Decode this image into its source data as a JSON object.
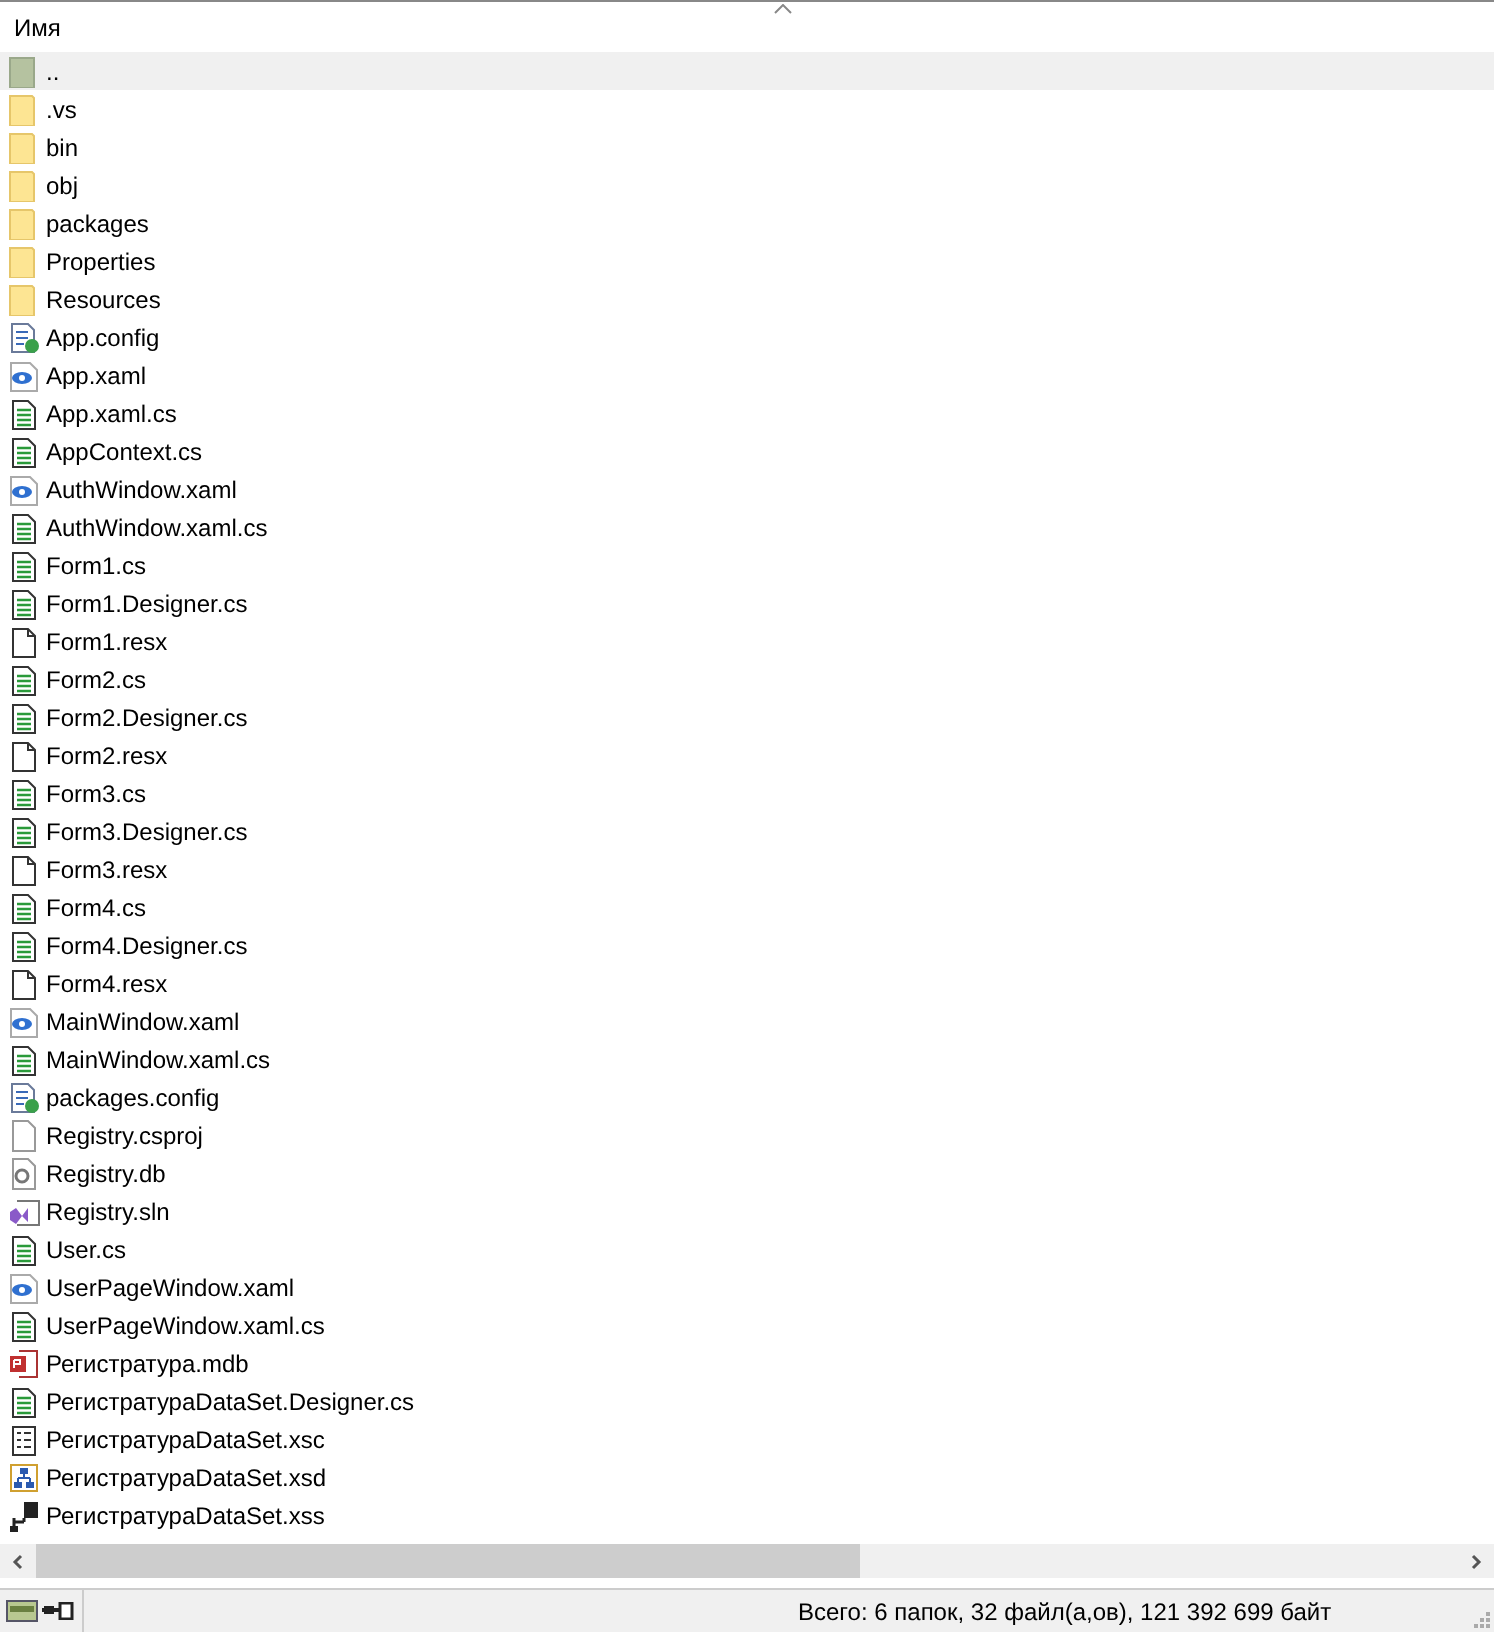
{
  "column": {
    "label": "Имя",
    "sort_ascending": true
  },
  "files": [
    {
      "name": "..",
      "kind": "up",
      "selected": true
    },
    {
      "name": ".vs",
      "kind": "folder",
      "selected": false
    },
    {
      "name": "bin",
      "kind": "folder",
      "selected": false
    },
    {
      "name": "obj",
      "kind": "folder",
      "selected": false
    },
    {
      "name": "packages",
      "kind": "folder",
      "selected": false
    },
    {
      "name": "Properties",
      "kind": "folder",
      "selected": false
    },
    {
      "name": "Resources",
      "kind": "folder",
      "selected": false
    },
    {
      "name": "App.config",
      "kind": "config",
      "selected": false
    },
    {
      "name": "App.xaml",
      "kind": "xaml",
      "selected": false
    },
    {
      "name": "App.xaml.cs",
      "kind": "cs",
      "selected": false
    },
    {
      "name": "AppContext.cs",
      "kind": "cs",
      "selected": false
    },
    {
      "name": "AuthWindow.xaml",
      "kind": "xaml",
      "selected": false
    },
    {
      "name": "AuthWindow.xaml.cs",
      "kind": "cs",
      "selected": false
    },
    {
      "name": "Form1.cs",
      "kind": "cs",
      "selected": false
    },
    {
      "name": "Form1.Designer.cs",
      "kind": "cs",
      "selected": false
    },
    {
      "name": "Form1.resx",
      "kind": "resx",
      "selected": false
    },
    {
      "name": "Form2.cs",
      "kind": "cs",
      "selected": false
    },
    {
      "name": "Form2.Designer.cs",
      "kind": "cs",
      "selected": false
    },
    {
      "name": "Form2.resx",
      "kind": "resx",
      "selected": false
    },
    {
      "name": "Form3.cs",
      "kind": "cs",
      "selected": false
    },
    {
      "name": "Form3.Designer.cs",
      "kind": "cs",
      "selected": false
    },
    {
      "name": "Form3.resx",
      "kind": "resx",
      "selected": false
    },
    {
      "name": "Form4.cs",
      "kind": "cs",
      "selected": false
    },
    {
      "name": "Form4.Designer.cs",
      "kind": "cs",
      "selected": false
    },
    {
      "name": "Form4.resx",
      "kind": "resx",
      "selected": false
    },
    {
      "name": "MainWindow.xaml",
      "kind": "xaml",
      "selected": false
    },
    {
      "name": "MainWindow.xaml.cs",
      "kind": "cs",
      "selected": false
    },
    {
      "name": "packages.config",
      "kind": "config",
      "selected": false
    },
    {
      "name": "Registry.csproj",
      "kind": "blank",
      "selected": false
    },
    {
      "name": "Registry.db",
      "kind": "db",
      "selected": false
    },
    {
      "name": "Registry.sln",
      "kind": "sln",
      "selected": false
    },
    {
      "name": "User.cs",
      "kind": "cs",
      "selected": false
    },
    {
      "name": "UserPageWindow.xaml",
      "kind": "xaml",
      "selected": false
    },
    {
      "name": "UserPageWindow.xaml.cs",
      "kind": "cs",
      "selected": false
    },
    {
      "name": "Регистратура.mdb",
      "kind": "mdb",
      "selected": false
    },
    {
      "name": "РегистратураDataSet.Designer.cs",
      "kind": "cs",
      "selected": false
    },
    {
      "name": "РегистратураDataSet.xsc",
      "kind": "xsc",
      "selected": false
    },
    {
      "name": "РегистратураDataSet.xsd",
      "kind": "xsd",
      "selected": false
    },
    {
      "name": "РегистратураDataSet.xss",
      "kind": "xss",
      "selected": false
    }
  ],
  "status_bar": {
    "text": "Всего: 6 папок, 32 файл(а,ов), 121 392 699 байт"
  }
}
